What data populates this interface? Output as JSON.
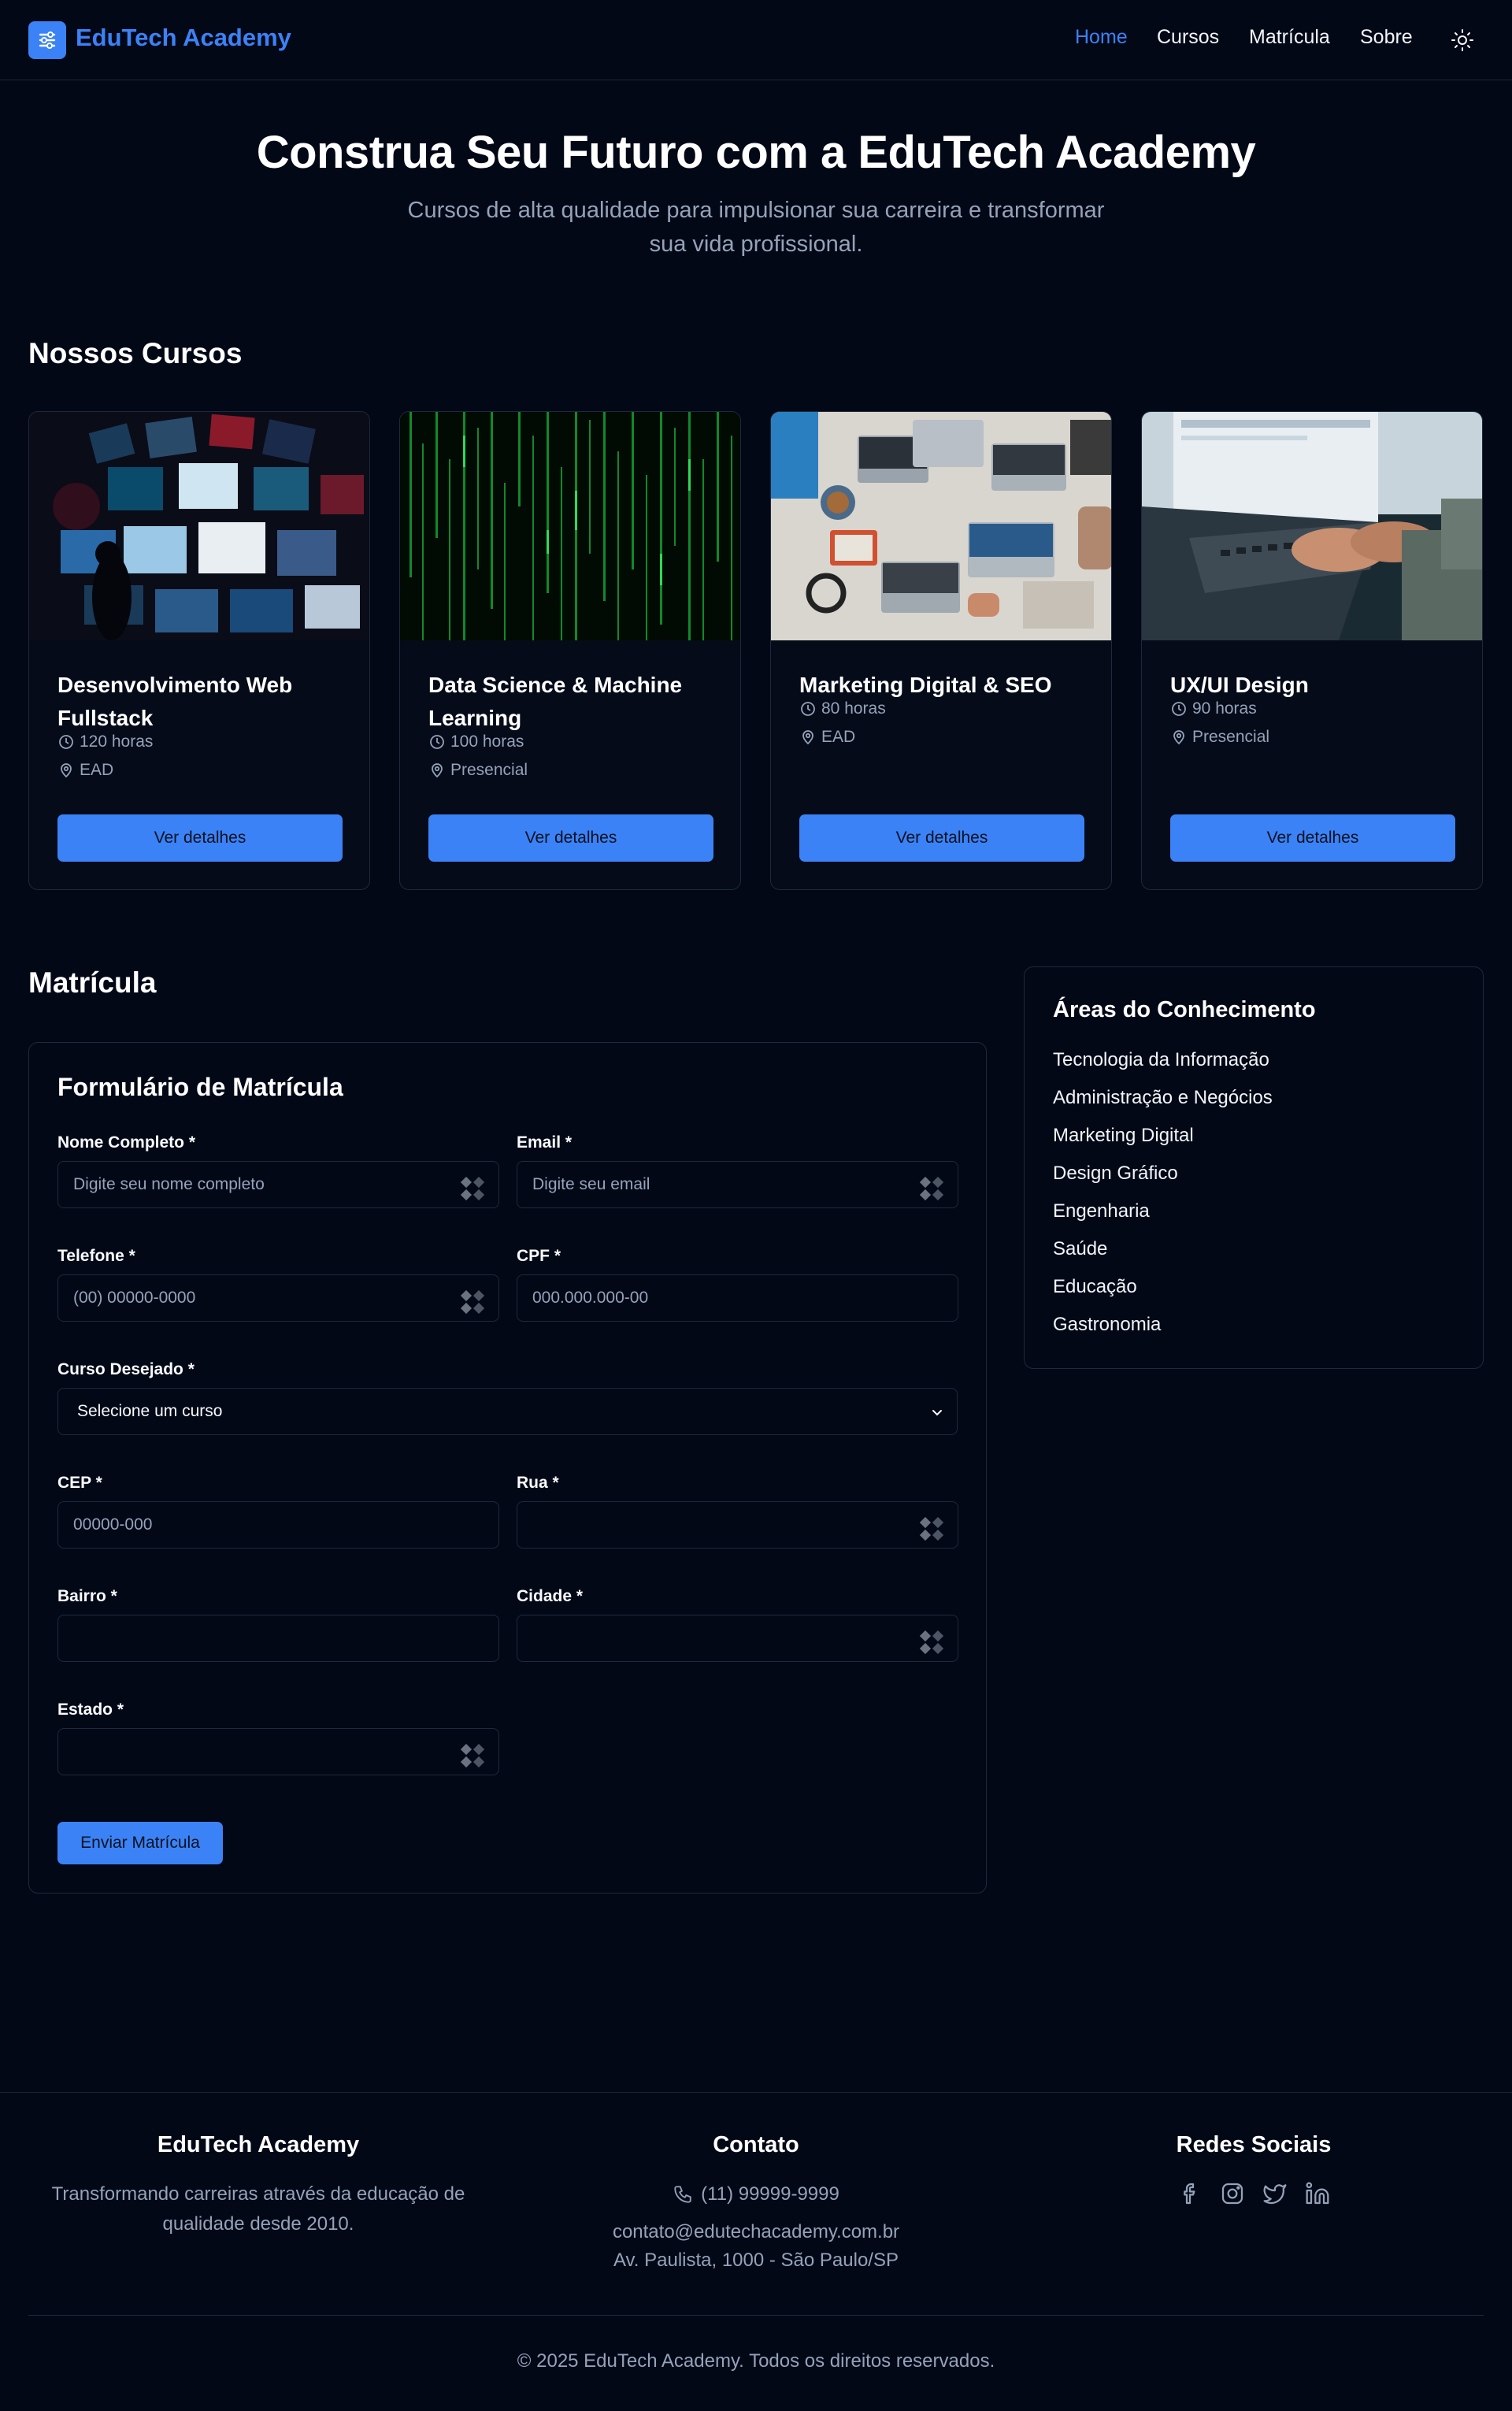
{
  "brand": {
    "name": "EduTech Academy",
    "accent": "#3b82f6"
  },
  "nav": {
    "items": [
      "Home",
      "Cursos",
      "Matrícula",
      "Sobre"
    ],
    "active": "Home"
  },
  "hero": {
    "title": "Construa Seu Futuro com a EduTech Academy",
    "subtitle_line1": "Cursos de alta qualidade para impulsionar sua carreira e transformar",
    "subtitle_line2": "sua vida profissional."
  },
  "courses_section": {
    "title": "Nossos Cursos"
  },
  "courses": [
    {
      "title_line1": "Desenvolvimento Web",
      "title_line2": "Fullstack",
      "hours": "120 horas",
      "mode": "EAD",
      "button": "Ver detalhes"
    },
    {
      "title_line1": "Data Science & Machine",
      "title_line2": "Learning",
      "hours": "100 horas",
      "mode": "Presencial",
      "button": "Ver detalhes"
    },
    {
      "title_line1": "Marketing Digital & SEO",
      "title_line2": "",
      "hours": "80 horas",
      "mode": "EAD",
      "button": "Ver detalhes"
    },
    {
      "title_line1": "UX/UI Design",
      "title_line2": "",
      "hours": "90 horas",
      "mode": "Presencial",
      "button": "Ver detalhes"
    }
  ],
  "enroll_section": {
    "title": "Matrícula"
  },
  "form": {
    "title": "Formulário de Matrícula",
    "fields": {
      "nome": {
        "label": "Nome Completo *",
        "placeholder": "Digite seu nome completo"
      },
      "email": {
        "label": "Email *",
        "placeholder": "Digite seu email"
      },
      "telefone": {
        "label": "Telefone *",
        "placeholder": "(00) 00000-0000"
      },
      "cpf": {
        "label": "CPF *",
        "placeholder": "000.000.000-00"
      },
      "curso": {
        "label": "Curso Desejado *",
        "value": "Selecione um curso"
      },
      "cep": {
        "label": "CEP *",
        "placeholder": "00000-000"
      },
      "rua": {
        "label": "Rua *",
        "placeholder": ""
      },
      "bairro": {
        "label": "Bairro *",
        "placeholder": ""
      },
      "cidade": {
        "label": "Cidade *",
        "placeholder": ""
      },
      "estado": {
        "label": "Estado *",
        "placeholder": ""
      }
    },
    "submit": "Enviar Matrícula"
  },
  "areas": {
    "title": "Áreas do Conhecimento",
    "items": [
      "Tecnologia da Informação",
      "Administração e Negócios",
      "Marketing Digital",
      "Design Gráfico",
      "Engenharia",
      "Saúde",
      "Educação",
      "Gastronomia"
    ]
  },
  "footer": {
    "about_title": "EduTech Academy",
    "about_line1": "Transformando carreiras através da educação de",
    "about_line2": "qualidade desde 2010.",
    "contact_title": "Contato",
    "phone": "(11) 99999-9999",
    "email": "contato@edutechacademy.com.br",
    "address": "Av. Paulista, 1000 - São Paulo/SP",
    "social_title": "Redes Sociais",
    "social_icons": [
      "facebook-icon",
      "instagram-icon",
      "twitter-icon",
      "linkedin-icon"
    ],
    "copyright": "© 2025 EduTech Academy. Todos os direitos reservados."
  }
}
